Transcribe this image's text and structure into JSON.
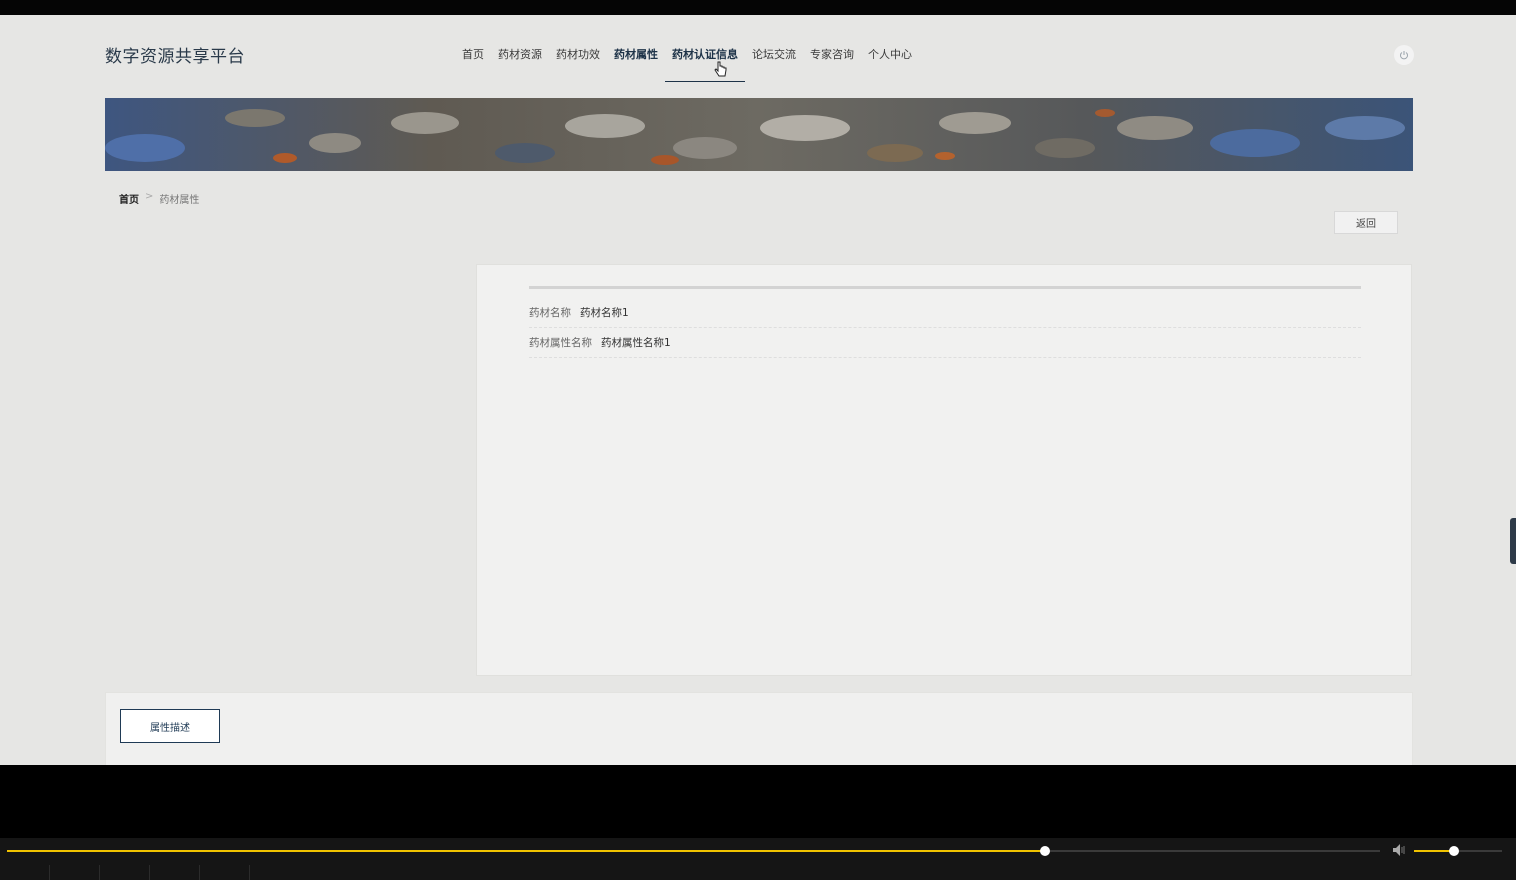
{
  "site": {
    "title": "数字资源共享平台"
  },
  "nav": {
    "items": [
      {
        "label": "首页"
      },
      {
        "label": "药材资源"
      },
      {
        "label": "药材功效"
      },
      {
        "label": "药材属性"
      },
      {
        "label": "药材认证信息"
      },
      {
        "label": "论坛交流"
      },
      {
        "label": "专家咨询"
      },
      {
        "label": "个人中心"
      }
    ],
    "active": "药材属性",
    "hovered": "药材认证信息"
  },
  "header": {
    "power_icon": "power-icon"
  },
  "banner": {
    "dots": 1,
    "active_dot": 0
  },
  "breadcrumb": {
    "home": "首页",
    "separator": ">",
    "current": "药材属性"
  },
  "actions": {
    "back_label": "返回"
  },
  "detail": {
    "fields": [
      {
        "label": "药材名称",
        "value": "药材名称1"
      },
      {
        "label": "药材属性名称",
        "value": "药材属性名称1"
      }
    ]
  },
  "bottom": {
    "tab_label": "属性描述"
  },
  "player": {
    "progress": 0.756,
    "volume": 0.45,
    "accent_color": "#f0c200",
    "volume_icon": "speaker-icon"
  },
  "colors": {
    "nav_active": "#1e3348",
    "page_bg": "#e6e6e4"
  }
}
